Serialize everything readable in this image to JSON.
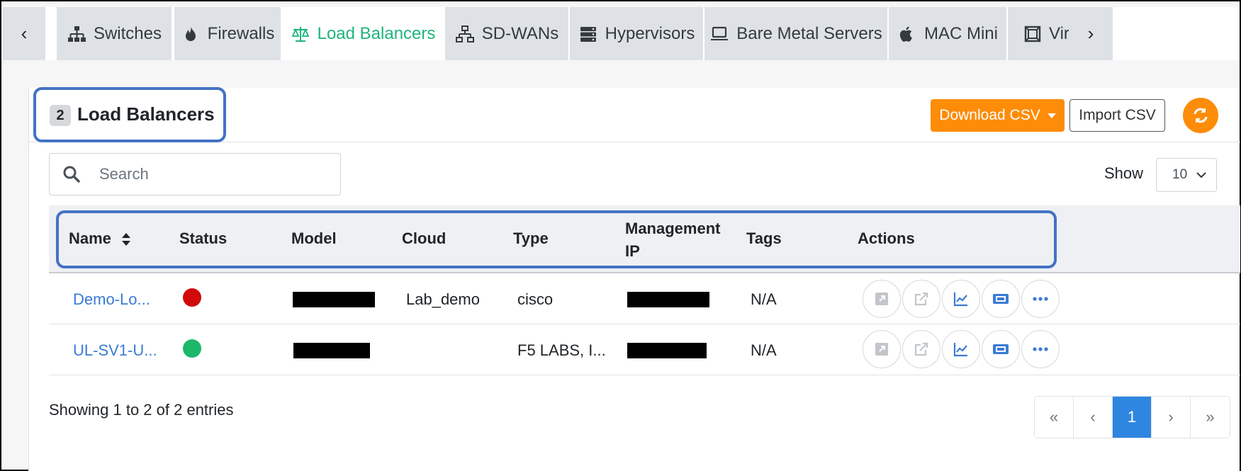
{
  "tabs": {
    "prev_icon": "chevron-left-icon",
    "next_icon": "chevron-right-icon",
    "prev_label": "‹",
    "next_label": "›",
    "items": [
      {
        "label": "Switches",
        "icon": "network-icon"
      },
      {
        "label": "Firewalls",
        "icon": "flame-icon"
      },
      {
        "label": "Load Balancers",
        "icon": "scale-icon",
        "active": true
      },
      {
        "label": "SD-WANs",
        "icon": "sitemap-icon"
      },
      {
        "label": "Hypervisors",
        "icon": "server-icon"
      },
      {
        "label": "Bare Metal Servers",
        "icon": "laptop-icon"
      },
      {
        "label": "MAC Mini",
        "icon": "apple-icon"
      },
      {
        "label": "Virtu",
        "icon": "virtual-icon"
      }
    ]
  },
  "header": {
    "count": "2",
    "title": "Load Balancers",
    "download_label": "Download CSV",
    "import_label": "Import CSV"
  },
  "search": {
    "placeholder": "Search"
  },
  "show": {
    "label": "Show",
    "value": "10"
  },
  "table": {
    "columns": [
      "Name",
      "Status",
      "Model",
      "Cloud",
      "Type",
      "Management IP",
      "Tags",
      "Actions"
    ],
    "column_lines": {
      "management_1": "Management",
      "management_2": "IP"
    },
    "rows": [
      {
        "name": "Demo-Lo...",
        "status": "down",
        "status_color": "#d10a0a",
        "cloud": "Lab_demo",
        "type": "cisco",
        "tags": "N/A"
      },
      {
        "name": "UL-SV1-U...",
        "status": "up",
        "status_color": "#1db86a",
        "cloud": "",
        "type": "F5 LABS, I...",
        "tags": "N/A"
      }
    ],
    "action_icons": [
      "expand-icon",
      "external-link-icon",
      "chart-line-icon",
      "ticket-icon",
      "more-icon"
    ]
  },
  "footer": {
    "info": "Showing 1 to 2 of 2 entries",
    "pages": [
      "«",
      "‹",
      "1",
      "›",
      "»"
    ],
    "current_page": "1"
  },
  "colors": {
    "accent": "#fd8c08",
    "active_tab": "#1fb57a",
    "link": "#3a7bd5",
    "highlight": "#4472c4",
    "page_active": "#2f86e0"
  }
}
